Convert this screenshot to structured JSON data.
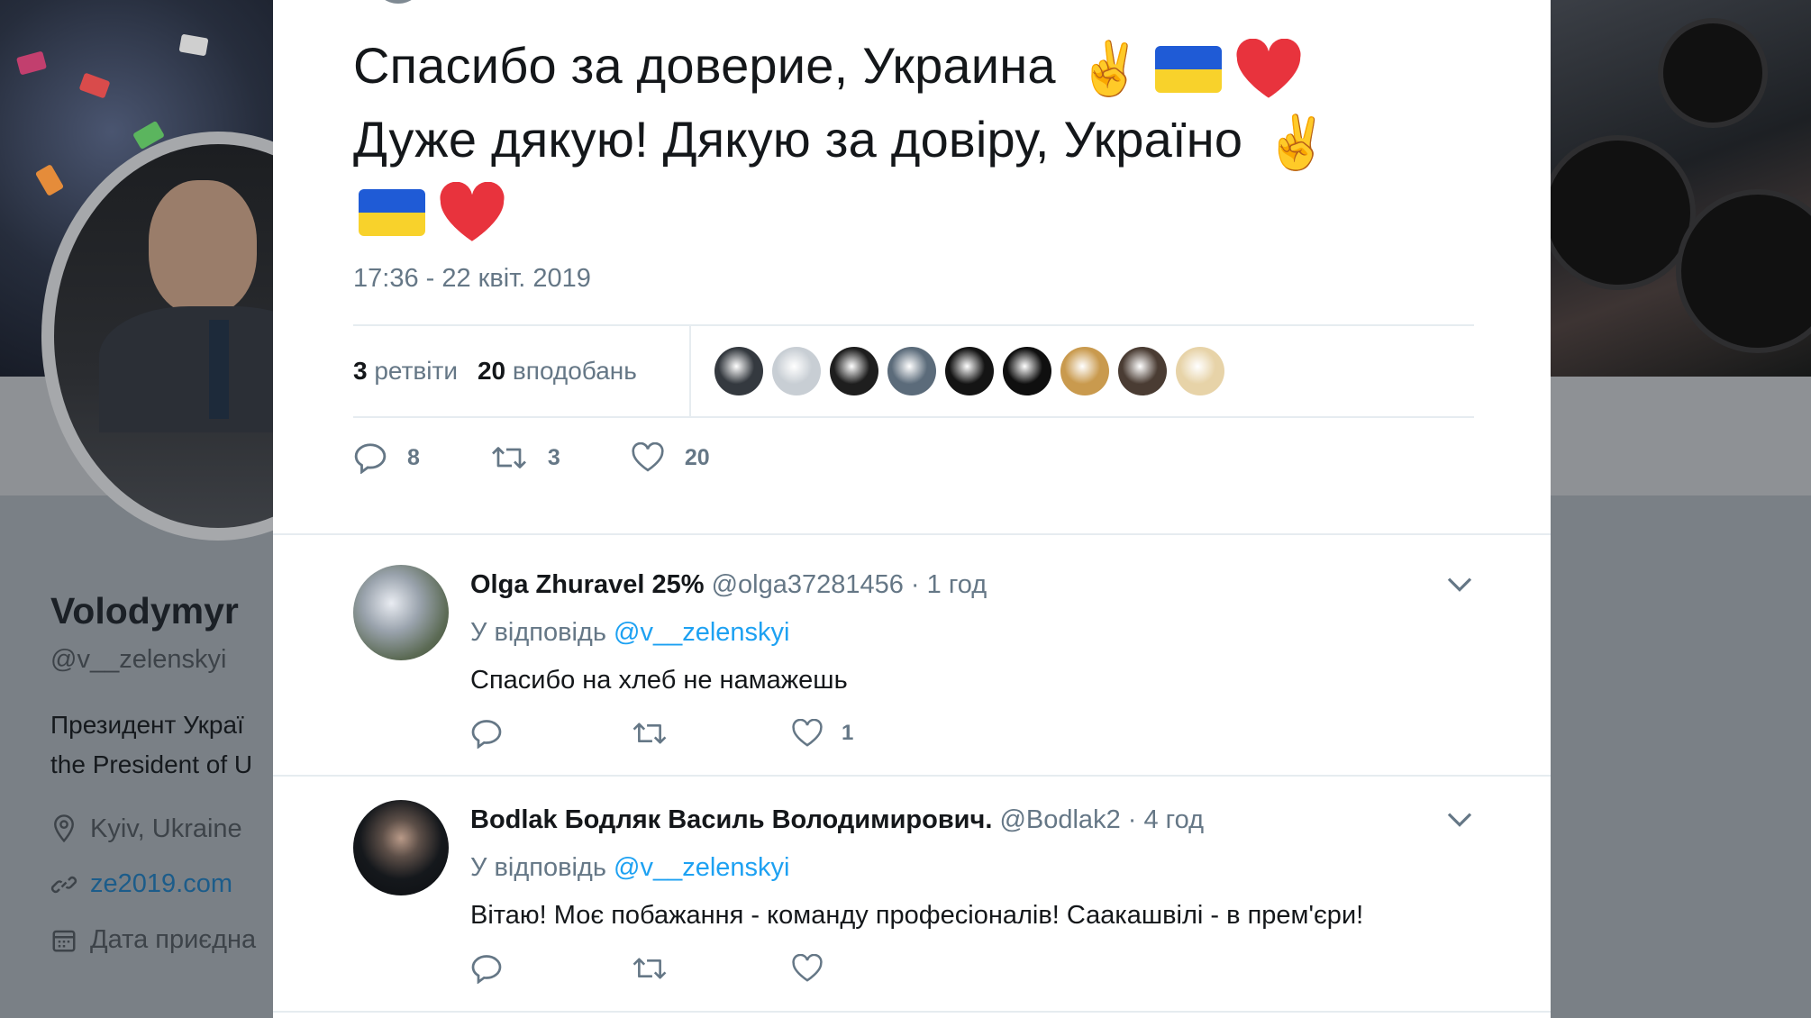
{
  "background_profile": {
    "name": "Volodymyr",
    "handle": "@v__zelenskyi",
    "bio_lines": [
      "Президент Украї",
      "the President of U"
    ],
    "location": "Kyiv, Ukraine",
    "website": "ze2019.com",
    "joined": "Дата приєдна"
  },
  "tweet": {
    "line1": "Спасибо за доверие, Украина",
    "line2": "Дуже дякую! Дякую за довіру, Україно",
    "timestamp": "17:36 - 22 квіт. 2019",
    "stats": {
      "retweets_count": "3",
      "retweets_label": "ретвіти",
      "likes_count": "20",
      "likes_label": "вподобань"
    },
    "actions": {
      "reply_count": "8",
      "retweet_count": "3",
      "like_count": "20"
    },
    "liker_colors": [
      "#34393f",
      "#c8ced4",
      "#1e1e1e",
      "#5b6b7a",
      "#141414",
      "#0f0f0f",
      "#c99a4e",
      "#4a3c33",
      "#e7d3a8"
    ]
  },
  "replies": [
    {
      "name": "Olga Zhuravel 25%",
      "handle": "@olga37281456",
      "time": "· 1 год",
      "reply_to_label": "У відповідь",
      "reply_to_mention": "@v__zelenskyi",
      "text": "Спасибо на хлеб не намажешь",
      "like_count": "1",
      "avatar_color": "#6f7b6a"
    },
    {
      "name": "Bodlak Бодляк Василь Володимирович.",
      "handle": "@Bodlak2",
      "time": "· 4 год",
      "reply_to_label": "У відповідь",
      "reply_to_mention": "@v__zelenskyi",
      "text": "Вітаю! Моє побажання - команду професіоналів! Саакашвілі  -  в прем'єри!",
      "like_count": "",
      "avatar_color": "#1c1f24"
    }
  ],
  "colors": {
    "accent": "#1da1f2",
    "text_primary": "#14171a",
    "text_secondary": "#657786",
    "flag_blue": "#1f5bd6",
    "flag_yellow": "#f8d22b",
    "heart": "#e0245e"
  }
}
